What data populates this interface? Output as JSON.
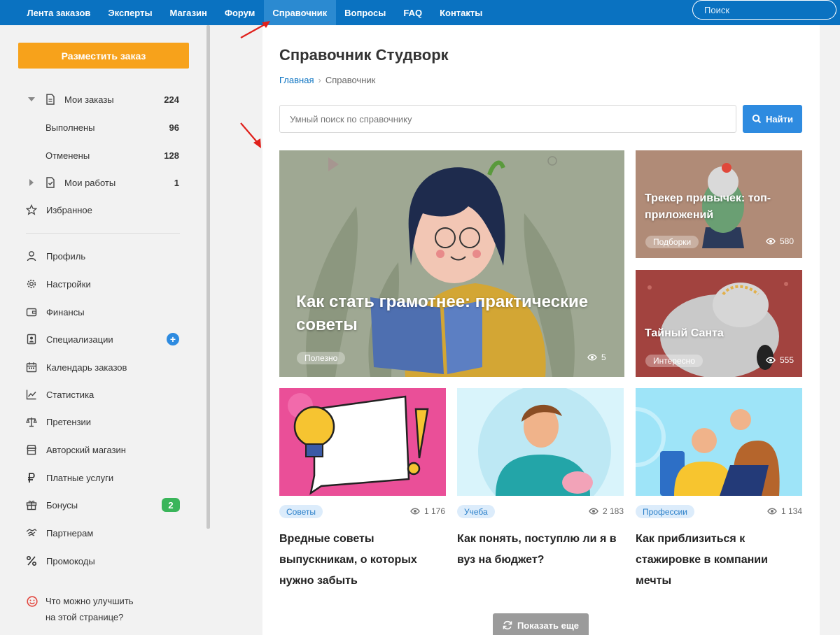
{
  "topnav": {
    "items": [
      "Лента заказов",
      "Эксперты",
      "Магазин",
      "Форум",
      "Справочник",
      "Вопросы",
      "FAQ",
      "Контакты"
    ],
    "active": "Справочник",
    "search_placeholder": "Поиск"
  },
  "sidebar": {
    "order_button": "Разместить заказ",
    "my_orders": {
      "label": "Мои заказы",
      "count": "224"
    },
    "done": {
      "label": "Выполнены",
      "count": "96"
    },
    "cancelled": {
      "label": "Отменены",
      "count": "128"
    },
    "my_works": {
      "label": "Мои работы",
      "count": "1"
    },
    "favorites": "Избранное",
    "menu": [
      "Профиль",
      "Настройки",
      "Финансы",
      "Специализации",
      "Календарь заказов",
      "Статистика",
      "Претензии",
      "Авторский магазин",
      "Платные услуги",
      "Бонусы",
      "Партнерам",
      "Промокоды"
    ],
    "bonus_badge": "2",
    "spec_badge": "+",
    "improve_line1": "Что можно улучшить",
    "improve_line2": "на этой странице?"
  },
  "main": {
    "title": "Справочник Студворк",
    "breadcrumb_home": "Главная",
    "breadcrumb_sep": "›",
    "breadcrumb_current": "Справочник",
    "search_placeholder": "Умный поиск по справочнику",
    "find_button": "Найти",
    "big_card": {
      "title_line1": "Как стать грамотнее: практические",
      "title_line2": "советы",
      "tag": "Полезно",
      "views": "5"
    },
    "card_tracker": {
      "title_line1": "Трекер привычек: топ-",
      "title_line2": "приложений",
      "tag": "Подборки",
      "views": "580"
    },
    "card_santa": {
      "title": "Тайный Санта",
      "tag": "Интересно",
      "views": "555"
    },
    "cards": [
      {
        "tag": "Советы",
        "views": "1 176",
        "title": "Вредные советы выпускникам, о которых нужно забыть"
      },
      {
        "tag": "Учеба",
        "views": "2 183",
        "title": "Как понять, поступлю ли я в вуз на бюджет?"
      },
      {
        "tag": "Профессии",
        "views": "1 134",
        "title": "Как приблизиться к стажировке в компании мечты"
      }
    ],
    "more_button": "Показать еще"
  },
  "colors": {
    "nav": "#0a72c1",
    "accent": "#f7a21b",
    "link": "#2e8be0"
  }
}
